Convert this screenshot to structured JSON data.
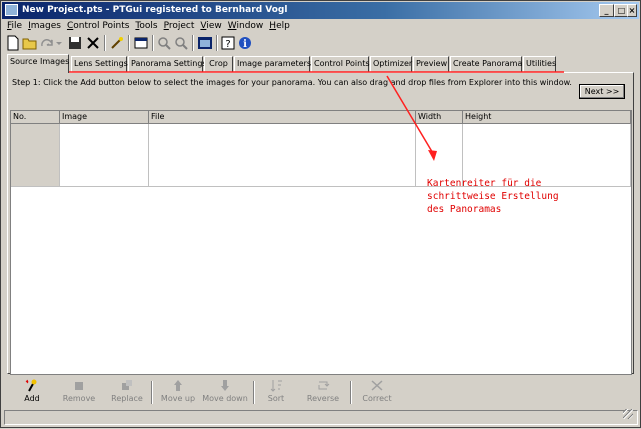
{
  "window": {
    "title": "New Project.pts - PTGui registered to Bernhard Vogl"
  },
  "menu": [
    {
      "label": "File",
      "ul": "F",
      "rest": "ile"
    },
    {
      "label": "Images",
      "ul": "I",
      "rest": "mages"
    },
    {
      "label": "Control Points",
      "ul": "C",
      "rest": "ontrol Points"
    },
    {
      "label": "Tools",
      "ul": "T",
      "rest": "ools"
    },
    {
      "label": "Project",
      "ul": "P",
      "rest": "roject"
    },
    {
      "label": "View",
      "ul": "V",
      "rest": "iew"
    },
    {
      "label": "Window",
      "ul": "W",
      "rest": "indow"
    },
    {
      "label": "Help",
      "ul": "H",
      "rest": "elp"
    }
  ],
  "toolbar": {
    "icons": [
      "new-icon",
      "open-icon",
      "redo-icon",
      "dropdown-icon",
      "save-icon",
      "delete-icon",
      "magic-wand-icon",
      "settings-icon",
      "zoom-in-icon",
      "zoom-out-icon",
      "panorama-editor-icon",
      "help-icon",
      "info-icon"
    ]
  },
  "tabs": [
    {
      "label": "Source Images",
      "active": true
    },
    {
      "label": "Lens Settings"
    },
    {
      "label": "Panorama Settings"
    },
    {
      "label": "Crop"
    },
    {
      "label": "Image parameters"
    },
    {
      "label": "Control Points"
    },
    {
      "label": "Optimizer"
    },
    {
      "label": "Preview"
    },
    {
      "label": "Create Panorama"
    },
    {
      "label": "Utilities"
    }
  ],
  "source_images": {
    "instructions": "Step 1: Click the Add button below to select the images for your panorama. You can also drag and drop files from Explorer into this window.",
    "next_label": "Next >>",
    "columns": [
      "No.",
      "Image",
      "File",
      "Width",
      "Height"
    ]
  },
  "annotation": {
    "lines": [
      "Kartenreiter für die",
      "schrittweise Erstellung",
      "des Panoramas"
    ],
    "color": "#e00000"
  },
  "actions": [
    {
      "label": "Add",
      "icon": "add-icon",
      "enabled": true
    },
    {
      "label": "Remove",
      "icon": "remove-icon",
      "enabled": false
    },
    {
      "label": "Replace",
      "icon": "replace-icon",
      "enabled": false
    },
    {
      "label": "Move up",
      "icon": "move-up-icon",
      "enabled": false
    },
    {
      "label": "Move down",
      "icon": "move-down-icon",
      "enabled": false
    },
    {
      "label": "Sort",
      "icon": "sort-icon",
      "enabled": false
    },
    {
      "label": "Reverse",
      "icon": "reverse-icon",
      "enabled": false
    },
    {
      "label": "Correct",
      "icon": "correct-icon",
      "enabled": false
    }
  ]
}
